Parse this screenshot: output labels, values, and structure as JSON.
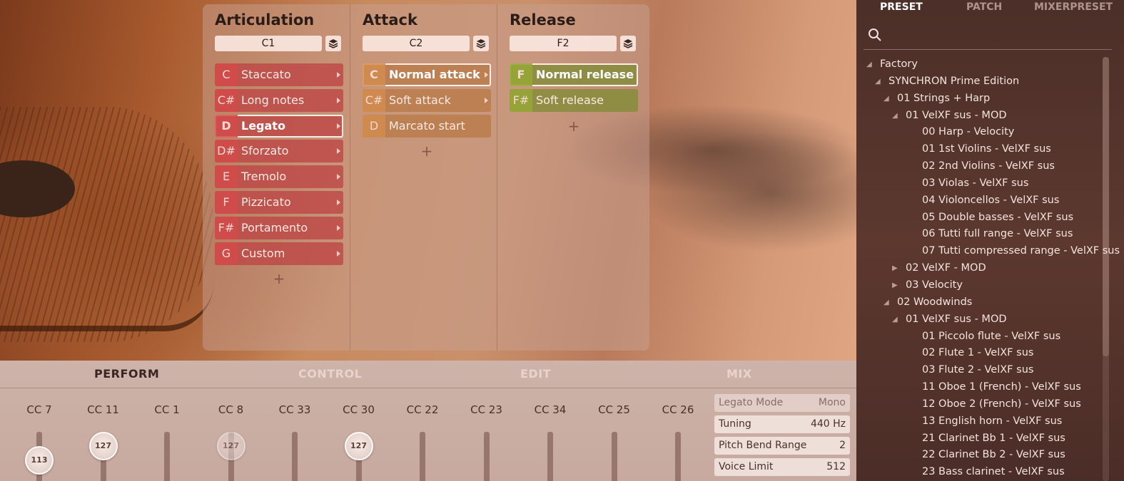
{
  "articulation": {
    "title": "Articulation",
    "key": "C1",
    "items": [
      {
        "key": "C",
        "label": "Staccato"
      },
      {
        "key": "C#",
        "label": "Long notes"
      },
      {
        "key": "D",
        "label": "Legato"
      },
      {
        "key": "D#",
        "label": "Sforzato"
      },
      {
        "key": "E",
        "label": "Tremolo"
      },
      {
        "key": "F",
        "label": "Pizzicato"
      },
      {
        "key": "F#",
        "label": "Portamento"
      },
      {
        "key": "G",
        "label": "Custom"
      }
    ],
    "selected": 2,
    "add": "+"
  },
  "attack": {
    "title": "Attack",
    "key": "C2",
    "items": [
      {
        "key": "C",
        "label": "Normal attack"
      },
      {
        "key": "C#",
        "label": "Soft attack"
      },
      {
        "key": "D",
        "label": "Marcato start"
      }
    ],
    "selected": 0,
    "add": "+"
  },
  "release": {
    "title": "Release",
    "key": "F2",
    "items": [
      {
        "key": "F",
        "label": "Normal release"
      },
      {
        "key": "F#",
        "label": "Soft release"
      }
    ],
    "selected": 0,
    "add": "+"
  },
  "colors": {
    "articulation": "#be4646",
    "attack": "#b97846",
    "release": "#828c37"
  },
  "perform": {
    "tabs": [
      "PERFORM",
      "CONTROL",
      "EDIT",
      "MIX"
    ],
    "active_tab": 0,
    "controllers": [
      {
        "label": "CC 7",
        "value": "113"
      },
      {
        "label": "CC 11",
        "value": "127"
      },
      {
        "label": "CC 1",
        "value": ""
      },
      {
        "label": "CC 8",
        "value": "127"
      },
      {
        "label": "CC 33",
        "value": ""
      },
      {
        "label": "CC 30",
        "value": "127"
      },
      {
        "label": "CC 22",
        "value": ""
      },
      {
        "label": "CC 23",
        "value": ""
      },
      {
        "label": "CC 34",
        "value": ""
      },
      {
        "label": "CC 25",
        "value": ""
      },
      {
        "label": "CC 26",
        "value": ""
      }
    ],
    "params": [
      {
        "label": "Legato Mode",
        "value": "Mono"
      },
      {
        "label": "Tuning",
        "value": "440 Hz"
      },
      {
        "label": "Pitch Bend Range",
        "value": "2"
      },
      {
        "label": "Voice Limit",
        "value": "512"
      }
    ]
  },
  "browser": {
    "tabs": [
      "PRESET",
      "PATCH",
      "MIXERPRESET"
    ],
    "active_tab": 0,
    "search_placeholder": "",
    "tree": [
      {
        "label": "Factory",
        "level": 0,
        "state": "open"
      },
      {
        "label": "SYNCHRON Prime Edition",
        "level": 1,
        "state": "open"
      },
      {
        "label": "01 Strings + Harp",
        "level": 2,
        "state": "open"
      },
      {
        "label": "01 VelXF sus - MOD",
        "level": 3,
        "state": "open"
      },
      {
        "label": "00 Harp - Velocity",
        "level": 4,
        "state": "leaf"
      },
      {
        "label": "01 1st Violins - VelXF sus",
        "level": 4,
        "state": "leaf"
      },
      {
        "label": "02 2nd Violins - VelXF sus",
        "level": 4,
        "state": "leaf"
      },
      {
        "label": "03 Violas - VelXF sus",
        "level": 4,
        "state": "leaf"
      },
      {
        "label": "04 Violoncellos - VelXF sus",
        "level": 4,
        "state": "leaf"
      },
      {
        "label": "05 Double basses - VelXF sus",
        "level": 4,
        "state": "leaf"
      },
      {
        "label": "06 Tutti full range - VelXF sus",
        "level": 4,
        "state": "leaf"
      },
      {
        "label": "07 Tutti compressed range - VelXF sus",
        "level": 4,
        "state": "leaf"
      },
      {
        "label": "02 VelXF - MOD",
        "level": 3,
        "state": "closed"
      },
      {
        "label": "03 Velocity",
        "level": 3,
        "state": "closed"
      },
      {
        "label": "02 Woodwinds",
        "level": 2,
        "state": "open"
      },
      {
        "label": "01 VelXF sus - MOD",
        "level": 3,
        "state": "open"
      },
      {
        "label": "01 Piccolo flute - VelXF sus",
        "level": 4,
        "state": "leaf"
      },
      {
        "label": "02 Flute 1 - VelXF sus",
        "level": 4,
        "state": "leaf"
      },
      {
        "label": "03 Flute 2 - VelXF sus",
        "level": 4,
        "state": "leaf"
      },
      {
        "label": "11 Oboe 1 (French) - VelXF sus",
        "level": 4,
        "state": "leaf"
      },
      {
        "label": "12 Oboe 2 (French) - VelXF sus",
        "level": 4,
        "state": "leaf"
      },
      {
        "label": "13 English horn - VelXF sus",
        "level": 4,
        "state": "leaf"
      },
      {
        "label": "21 Clarinet Bb 1 - VelXF sus",
        "level": 4,
        "state": "leaf"
      },
      {
        "label": "22 Clarinet Bb 2 - VelXF sus",
        "level": 4,
        "state": "leaf"
      },
      {
        "label": "23 Bass clarinet - VelXF sus",
        "level": 4,
        "state": "leaf"
      }
    ]
  }
}
